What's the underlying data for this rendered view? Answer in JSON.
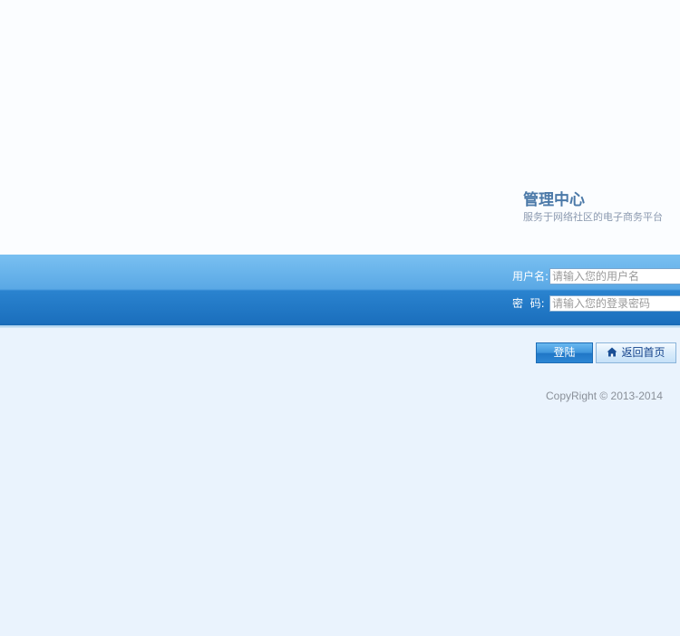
{
  "brand": {
    "title": "管理中心",
    "subtitle": "服务于网络社区的电子商务平台"
  },
  "login_form": {
    "username_label": "用户名:",
    "username_placeholder": "请输入您的用户名",
    "username_value": "",
    "password_label": "密  码:",
    "password_placeholder": "请输入您的登录密码",
    "password_value": ""
  },
  "buttons": {
    "login_label": "登陆",
    "home_label": "返回首页",
    "home_icon": "home-icon"
  },
  "footer": {
    "copyright": "CopyRight © 2013-2014"
  },
  "colors": {
    "band_top": "#79c0f1",
    "band_bottom": "#1566b1",
    "brand_title": "#4b79a8",
    "page_bg": "#eaf3fd"
  }
}
